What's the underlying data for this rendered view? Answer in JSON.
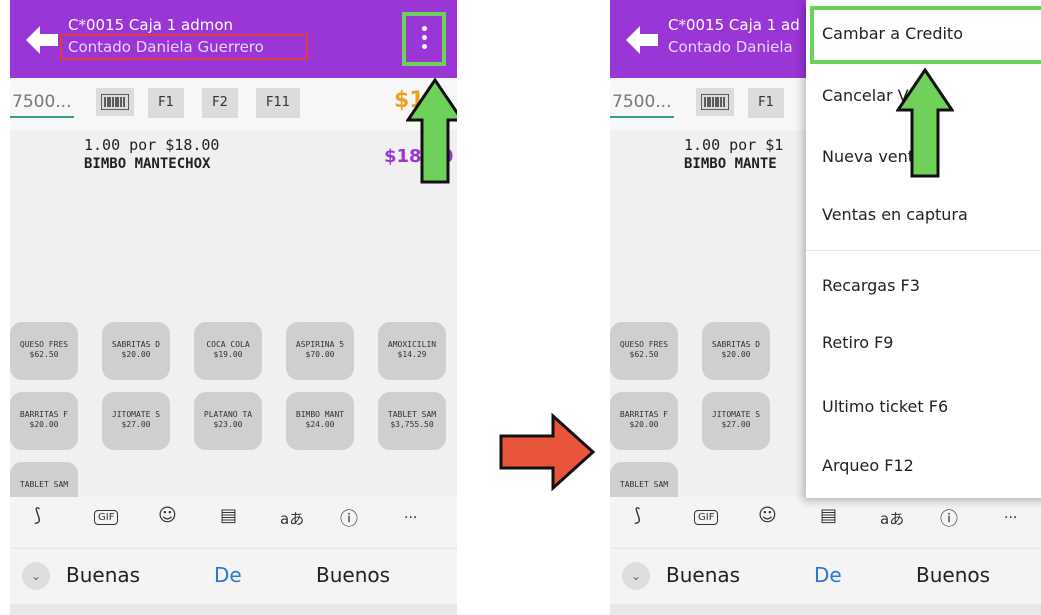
{
  "before": {
    "header": {
      "title": "C*0015 Caja 1 admon",
      "subtitle": "Contado Daniela Guerrero"
    },
    "toolbar": {
      "qty_placeholder": "7500...",
      "f1": "F1",
      "f2": "F2",
      "f11": "F11",
      "total": "$18"
    },
    "item": {
      "line1": "1.00 por $18.00",
      "line2": "BIMBO MANTECHOX",
      "price": "$18.00"
    },
    "tiles": [
      {
        "name": "QUESO FRES",
        "price": "$62.50"
      },
      {
        "name": "SABRITAS D",
        "price": "$20.00"
      },
      {
        "name": "COCA COLA",
        "price": "$19.00"
      },
      {
        "name": "ASPIRINA 5",
        "price": "$70.00"
      },
      {
        "name": "AMOXICILIN",
        "price": "$14.29"
      },
      {
        "name": "BARRITAS F",
        "price": "$20.00"
      },
      {
        "name": "JITOMATE S",
        "price": "$27.00"
      },
      {
        "name": "PLATANO TA",
        "price": "$23.00"
      },
      {
        "name": "BIMBO MANT",
        "price": "$24.00"
      },
      {
        "name": "TABLET SAM",
        "price": "$3,755.50"
      },
      {
        "name": "TABLET SAM",
        "price": ""
      }
    ]
  },
  "after": {
    "header": {
      "title": "C*0015 Caja 1 ad",
      "subtitle": "Contado Daniela"
    },
    "toolbar": {
      "qty_placeholder": "7500...",
      "f1": "F1"
    },
    "item": {
      "line1": "1.00 por $1",
      "line2": "BIMBO MANTE"
    },
    "tiles": [
      {
        "name": "QUESO FRES",
        "price": "$62.50"
      },
      {
        "name": "SABRITAS D",
        "price": "$20.00"
      },
      {
        "name": "BARRITAS F",
        "price": "$20.00"
      },
      {
        "name": "JITOMATE S",
        "price": "$27.00"
      },
      {
        "name": "TABLET SAM",
        "price": ""
      }
    ],
    "menu": [
      "Cambar a Credito",
      "Cancelar Venta",
      "Nueva venta",
      "Ventas en captura",
      "Recargas F3",
      "Retiro F9",
      "Ultimo ticket F6",
      "Arqueo F12"
    ]
  },
  "keyboard": {
    "gif_label": "GIF",
    "translate_label": "aあ",
    "more_label": "···",
    "suggestions": [
      "Buenas",
      "De",
      "Buenos"
    ]
  },
  "colors": {
    "header": "#9a35d6",
    "highlight_green": "#6ed25a",
    "highlight_red": "#e03a3a",
    "arrow_orange": "#e8553a",
    "price_purple": "#9a35d6"
  },
  "icons": [
    "back-arrow-icon",
    "kebab-menu-icon",
    "barcode-icon",
    "sticker-icon",
    "gif-icon",
    "emoji-icon",
    "clipboard-icon",
    "translate-icon",
    "info-icon",
    "more-icon",
    "chevron-down-icon",
    "up-arrow-icon",
    "right-arrow-icon"
  ]
}
